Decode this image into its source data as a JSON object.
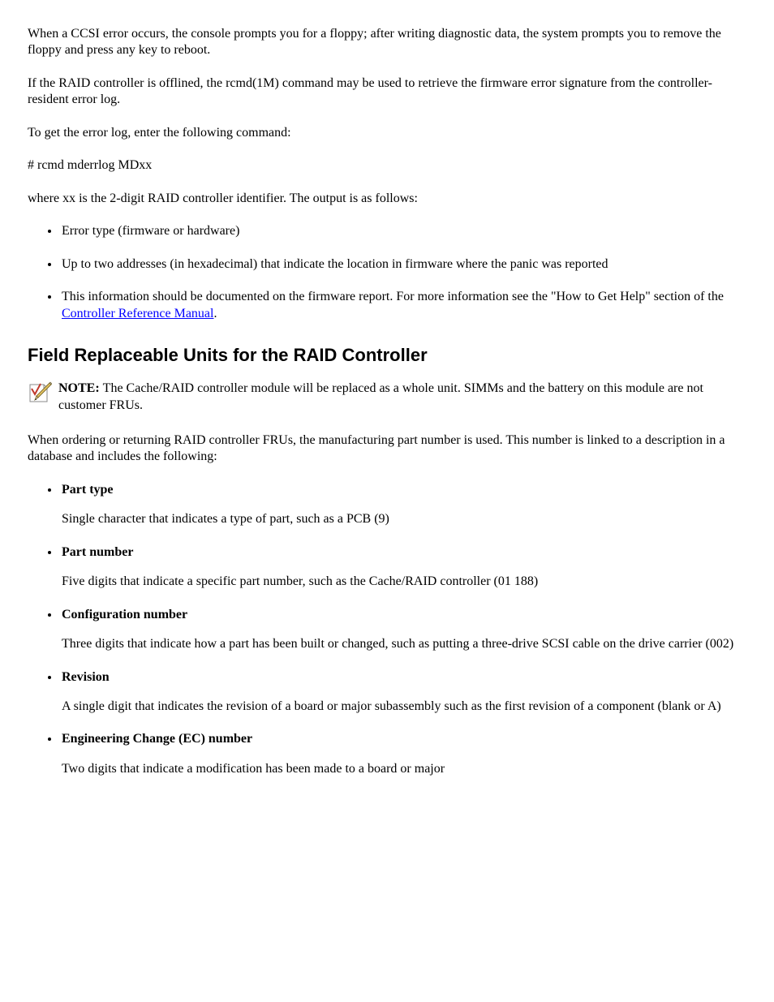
{
  "intro_para_1": "When a CCSI error occurs, the console prompts you for a floppy; after writing diagnostic data, the system prompts you to remove the floppy and press any key to reboot.",
  "intro_para_2a": "If the RAID controller is offlined, the ",
  "intro_rcmd": "rcmd(1M)",
  "intro_para_2b": " command may be used to retrieve the firmware error signature from the controller-resident error log.",
  "intro_para_3": "To get the error log, enter the following command:",
  "rcmd_command": "# rcmd mderrlog MDxx",
  "intro_para_4": "where xx is the 2-digit RAID controller identifier. The output is as follows:",
  "error_list": [
    "Error type (firmware or hardware)",
    "Up to two addresses (in hexadecimal) that indicate the location in firmware where the panic was reported",
    "This information should be documented on the firmware report. For more information see the \"How to Get Help\" section of the "
  ],
  "controller_rm_title": "Controller Reference Manual",
  "period": ".",
  "section_title": "Field Replaceable Units for the RAID Controller",
  "note_label": "NOTE: ",
  "note_body": "The Cache/RAID controller module will be replaced as a whole unit. SIMMs and the battery on this module are not customer FRUs.",
  "fields_intro": "When ordering or returning RAID controller FRUs, the manufacturing part number is used. This number is linked to a description in a database and includes the following:",
  "fields": [
    {
      "name": "Part type",
      "desc": "Single character that indicates a type of part, such as a PCB (9)"
    },
    {
      "name": "Part number",
      "desc": "Five digits that indicate a specific part number, such as the Cache/RAID controller (01 188)"
    },
    {
      "name": "Configuration number",
      "desc": "Three digits that indicate how a part has been built or changed, such as putting a three-drive SCSI cable on the drive carrier (002)"
    },
    {
      "name": "Revision",
      "desc": "A single digit that indicates the revision of a board or major subassembly such as the first revision of a component (blank or A)"
    },
    {
      "name": "Engineering Change (EC) number",
      "desc": "Two digits that indicate a modification has been made to a board or major"
    }
  ]
}
